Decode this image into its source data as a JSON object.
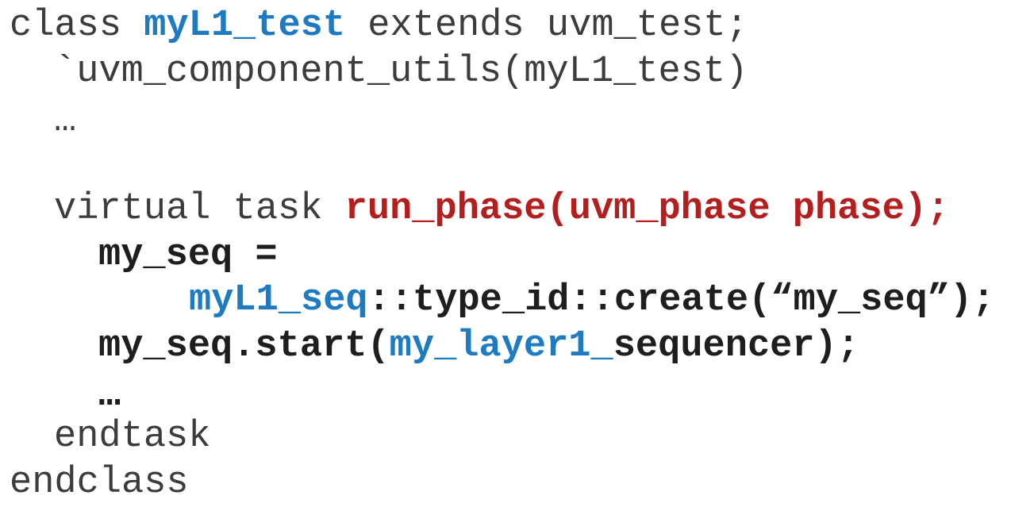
{
  "code": {
    "line1": {
      "kw": "class ",
      "name": "myL1_test",
      "rest": " extends uvm_test;"
    },
    "line2": {
      "text": "`uvm_component_utils(myL1_test)"
    },
    "line3": {
      "text": "…"
    },
    "line4": {
      "kw": "virtual task ",
      "sig": "run_phase(uvm_phase phase);"
    },
    "line5": {
      "text": "my_seq ="
    },
    "line6": {
      "cls": "myL1_seq",
      "rest": "::type_id::create(“my_seq”);"
    },
    "line7": {
      "pre": "my_seq.start(",
      "arg": "my_layer1_",
      "post": "sequencer);"
    },
    "line8": {
      "text": "…"
    },
    "line9": {
      "text": "endtask"
    },
    "line10": {
      "text": "endclass"
    }
  },
  "colors": {
    "keyword_text": "#3c3c3c",
    "bold_text": "#1e1e1e",
    "highlight_blue": "#1f7bc1",
    "highlight_red": "#b41e1e",
    "background": "#ffffff"
  }
}
